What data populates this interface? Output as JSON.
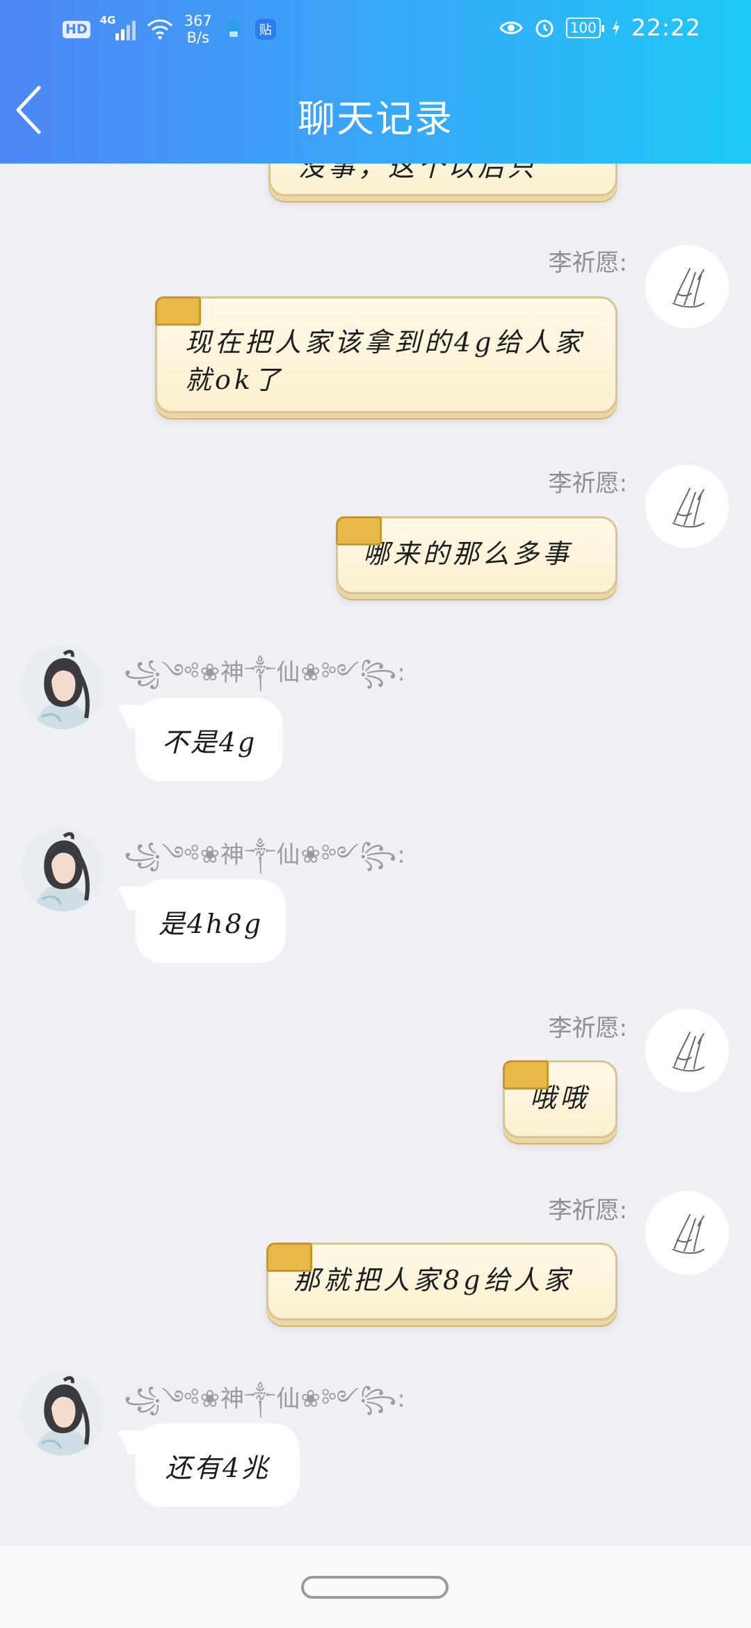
{
  "status_bar": {
    "hd": "HD",
    "network": "4G",
    "speed_value": "367",
    "speed_unit": "B/s",
    "paste_icon_label": "贴",
    "battery": "100",
    "time": "22:22"
  },
  "header": {
    "title": "聊天记录"
  },
  "messages": [
    {
      "side": "right",
      "sender": "",
      "text": "没事，这个以后只"
    },
    {
      "side": "right",
      "sender": "李祈愿:",
      "text": "现在把人家该拿到的4g给人家就ok了"
    },
    {
      "side": "right",
      "sender": "李祈愿:",
      "text": "哪来的那么多事"
    },
    {
      "side": "left",
      "sender": "꧁༺❀神༒仙❀༻꧂:",
      "text": "不是4g"
    },
    {
      "side": "left",
      "sender": "꧁༺❀神༒仙❀༻꧂:",
      "text": "是4h8g"
    },
    {
      "side": "right",
      "sender": "李祈愿:",
      "text": "哦哦"
    },
    {
      "side": "right",
      "sender": "李祈愿:",
      "text": "那就把人家8g给人家"
    },
    {
      "side": "left",
      "sender": "꧁༺❀神༒仙❀༻꧂:",
      "text": "还有4兆"
    }
  ],
  "colors": {
    "header_gradient_start": "#4d86f5",
    "header_gradient_end": "#1ec8f6",
    "chat_background": "#eff0f6",
    "scroll_tab": "#e7b94a"
  }
}
